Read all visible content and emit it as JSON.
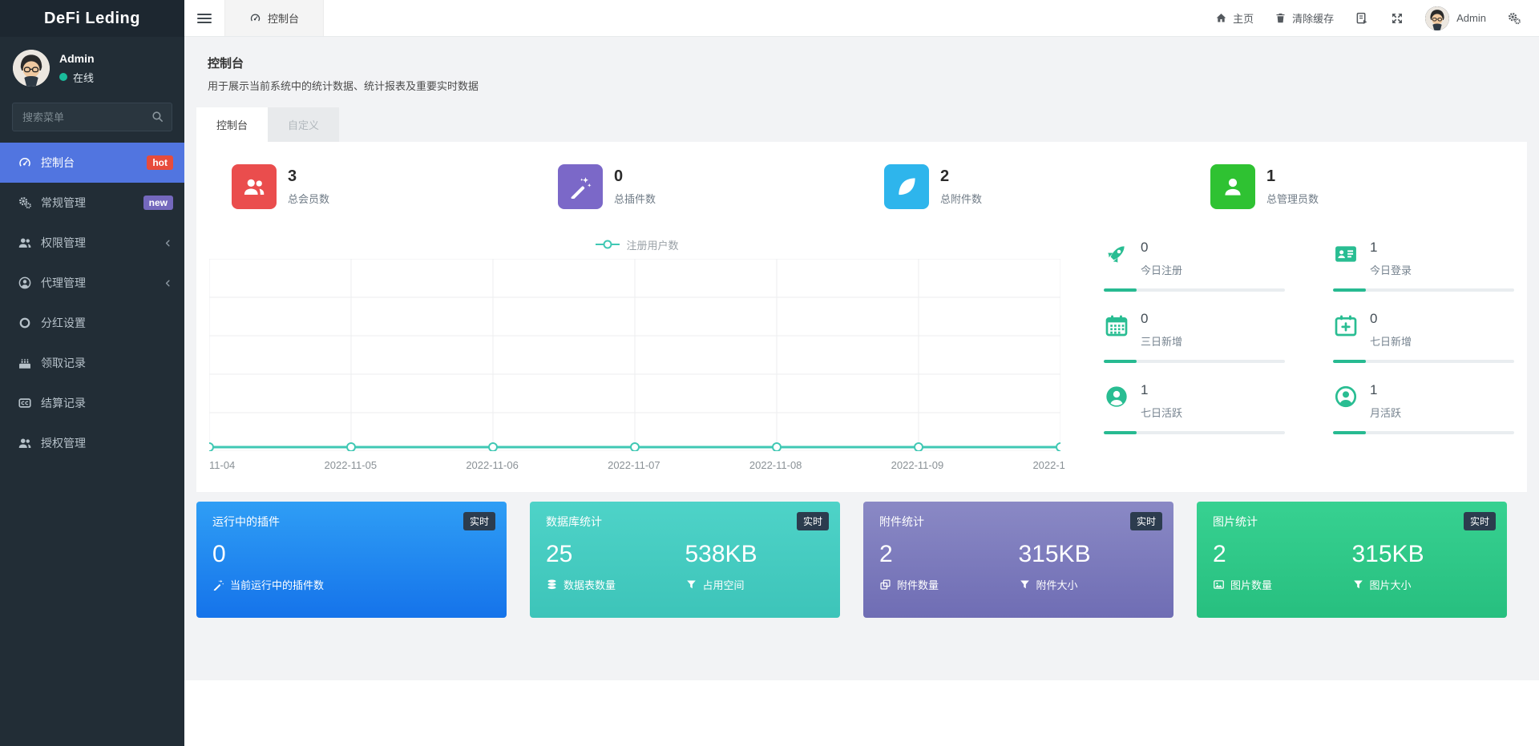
{
  "brand": "DeFi Leding",
  "colors": {
    "sidebar_bg": "#222d36",
    "active_item": "#5175e0",
    "hot_badge": "#e74c3c",
    "new_badge": "#7468bd",
    "online_dot": "#1abc9c",
    "stat_red": "#ea4d4d",
    "stat_purple": "#7b68c8",
    "stat_blue": "#2eb5ec",
    "stat_green": "#2fc232",
    "mini_teal": "#29bd92",
    "chart_teal": "#40c8b4"
  },
  "topbar": {
    "active_tab": "控制台",
    "home": "主页",
    "clear_cache": "清除缓存",
    "username": "Admin"
  },
  "sidebar": {
    "user": {
      "name": "Admin",
      "status": "在线"
    },
    "search_placeholder": "搜索菜单",
    "items": [
      {
        "label": "控制台",
        "icon": "gauge-icon",
        "badge": "hot",
        "active": true
      },
      {
        "label": "常规管理",
        "icon": "cogs-icon",
        "badge": "new"
      },
      {
        "label": "权限管理",
        "icon": "users-icon",
        "expandable": true
      },
      {
        "label": "代理管理",
        "icon": "user-circle-icon",
        "expandable": true
      },
      {
        "label": "分红设置",
        "icon": "circle-icon"
      },
      {
        "label": "领取记录",
        "icon": "birthday-cake-icon"
      },
      {
        "label": "结算记录",
        "icon": "closed-caption-icon"
      },
      {
        "label": "授权管理",
        "icon": "users-icon"
      }
    ]
  },
  "page": {
    "title": "控制台",
    "subtitle": "用于展示当前系统中的统计数据、统计报表及重要实时数据",
    "tabs": [
      {
        "label": "控制台",
        "active": true
      },
      {
        "label": "自定义",
        "active": false
      }
    ]
  },
  "stat_cards": [
    {
      "value": "3",
      "label": "总会员数",
      "icon": "users-icon",
      "color": "#ea4d4d"
    },
    {
      "value": "0",
      "label": "总插件数",
      "icon": "magic-wand-icon",
      "color": "#7b68c8"
    },
    {
      "value": "2",
      "label": "总附件数",
      "icon": "leaf-icon",
      "color": "#2eb5ec"
    },
    {
      "value": "1",
      "label": "总管理员数",
      "icon": "user-icon",
      "color": "#2fc232"
    }
  ],
  "chart_data": {
    "type": "line",
    "series": [
      {
        "name": "注册用户数",
        "values": [
          0,
          0,
          0,
          0,
          0,
          0,
          0
        ]
      }
    ],
    "x_labels": [
      "11-04",
      "2022-11-05",
      "2022-11-06",
      "2022-11-07",
      "2022-11-08",
      "2022-11-09",
      "2022-1"
    ],
    "ylim": [
      0,
      1
    ],
    "grid": true,
    "legend_position": "top-center",
    "line_color": "#40c8b4"
  },
  "mini_stats": [
    {
      "value": "0",
      "label": "今日注册",
      "icon": "rocket-icon",
      "bar_pct": 18
    },
    {
      "value": "1",
      "label": "今日登录",
      "icon": "id-card-icon",
      "bar_pct": 18
    },
    {
      "value": "0",
      "label": "三日新增",
      "icon": "calendar-icon",
      "bar_pct": 18
    },
    {
      "value": "0",
      "label": "七日新增",
      "icon": "calendar-plus-icon",
      "bar_pct": 18
    },
    {
      "value": "1",
      "label": "七日活跃",
      "icon": "user-circle-solid-icon",
      "bar_pct": 18
    },
    {
      "value": "1",
      "label": "月活跃",
      "icon": "user-circle-outline-icon",
      "bar_pct": 18
    }
  ],
  "bottom_cards": [
    {
      "title": "运行中的插件",
      "badge": "实时",
      "big_value": "0",
      "footer_icon": "magic-wand-icon",
      "footer_label": "当前运行中的插件数"
    },
    {
      "title": "数据库统计",
      "badge": "实时",
      "stats": [
        {
          "value": "25",
          "icon": "database-icon",
          "label": "数据表数量"
        },
        {
          "value": "538KB",
          "icon": "funnel-icon",
          "label": "占用空间"
        }
      ]
    },
    {
      "title": "附件统计",
      "badge": "实时",
      "stats": [
        {
          "value": "2",
          "icon": "clone-icon",
          "label": "附件数量"
        },
        {
          "value": "315KB",
          "icon": "funnel-icon",
          "label": "附件大小"
        }
      ]
    },
    {
      "title": "图片统计",
      "badge": "实时",
      "stats": [
        {
          "value": "2",
          "icon": "image-icon",
          "label": "图片数量"
        },
        {
          "value": "315KB",
          "icon": "funnel-icon",
          "label": "图片大小"
        }
      ]
    }
  ]
}
